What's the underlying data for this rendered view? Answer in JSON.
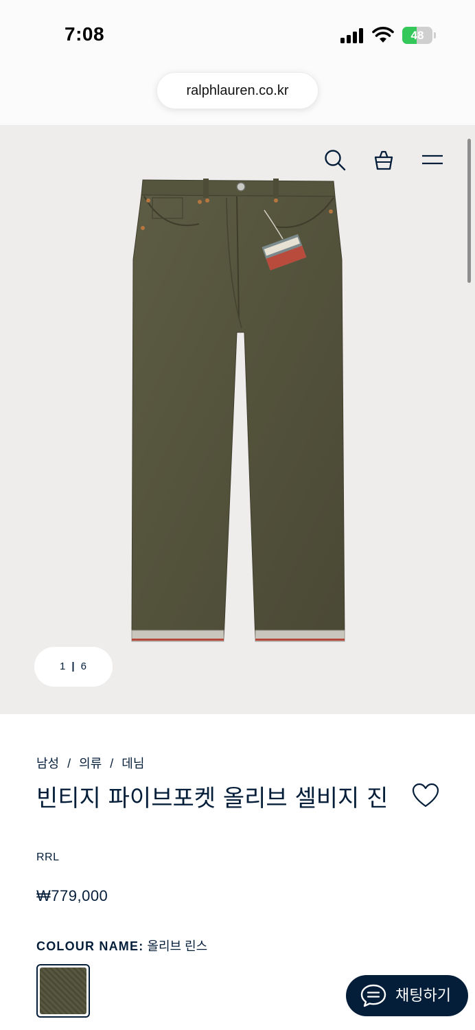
{
  "status_bar": {
    "time": "7:08",
    "battery_level": "48",
    "battery_fraction": 0.48,
    "battery_color": "#34c759"
  },
  "browser": {
    "url": "ralphlauren.co.kr"
  },
  "header_icons": [
    "search-icon",
    "shopping-bag-icon",
    "menu-icon"
  ],
  "gallery": {
    "current": "1",
    "separator": "|",
    "total": "6"
  },
  "breadcrumb": {
    "items": [
      "남성",
      "의류",
      "데님"
    ],
    "separator": "/"
  },
  "product": {
    "title": "빈티지 파이브포켓 올리브 셀비지 진",
    "brand": "RRL",
    "price": "₩779,000",
    "colour_label": "COLOUR NAME:",
    "colour_value": "올리브 린스",
    "product_color": "#56553e"
  },
  "chat": {
    "label": "채팅하기"
  },
  "colors": {
    "navy": "#041e3a",
    "hero_bg": "#efedec"
  }
}
